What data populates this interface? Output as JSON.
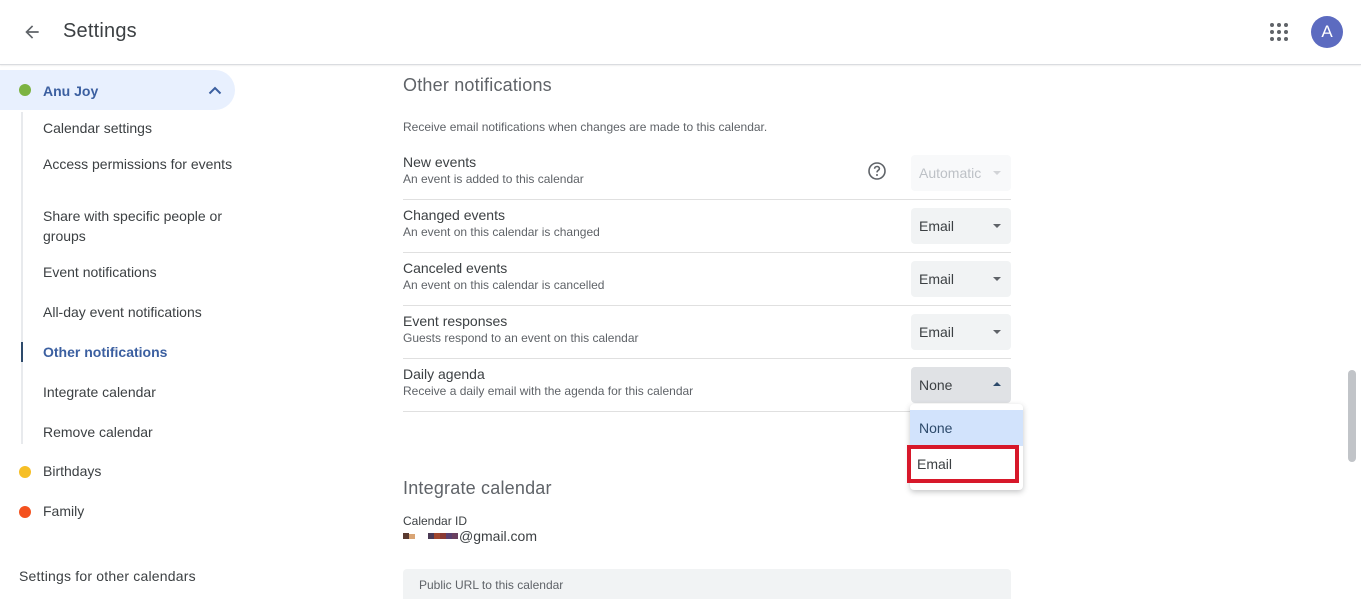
{
  "header": {
    "title": "Settings",
    "back_icon": "arrow-back-icon",
    "apps_icon": "apps-grid-icon",
    "avatar_initial": "A"
  },
  "sidebar": {
    "calendar": {
      "name": "Anu Joy",
      "color": "#7cb342",
      "expanded": true
    },
    "subitems": [
      {
        "label": "Calendar settings"
      },
      {
        "label": "Access permissions for events"
      },
      {
        "label": "Share with specific people or groups"
      },
      {
        "label": "Event notifications"
      },
      {
        "label": "All-day event notifications"
      },
      {
        "label": "Other notifications",
        "active": true
      },
      {
        "label": "Integrate calendar"
      },
      {
        "label": "Remove calendar"
      }
    ],
    "calendars": [
      {
        "name": "Birthdays",
        "color": "#f6bf26"
      },
      {
        "name": "Family",
        "color": "#f4511e"
      }
    ],
    "other_calendars_heading": "Settings for other calendars"
  },
  "main": {
    "other_notifications": {
      "title": "Other notifications",
      "description": "Receive email notifications when changes are made to this calendar.",
      "rows": [
        {
          "label": "New events",
          "desc": "An event is added to this calendar",
          "value": "Automatic",
          "disabled": true,
          "has_help": true
        },
        {
          "label": "Changed events",
          "desc": "An event on this calendar is changed",
          "value": "Email"
        },
        {
          "label": "Canceled events",
          "desc": "An event on this calendar is cancelled",
          "value": "Email"
        },
        {
          "label": "Event responses",
          "desc": "Guests respond to an event on this calendar",
          "value": "Email"
        },
        {
          "label": "Daily agenda",
          "desc": "Receive a daily email with the agenda for this calendar",
          "value": "None",
          "open": true
        }
      ],
      "dropdown_options": [
        {
          "label": "None",
          "selected": true
        },
        {
          "label": "Email",
          "highlighted": true
        }
      ]
    },
    "integrate_calendar": {
      "title": "Integrate calendar",
      "calendar_id_label": "Calendar ID",
      "calendar_id_suffix": "@gmail.com",
      "public_url_label": "Public URL to this calendar"
    }
  },
  "colors": {
    "accent": "#3b5fa0",
    "highlight_box": "#d7182a",
    "avatar": "#5c6bc0"
  }
}
